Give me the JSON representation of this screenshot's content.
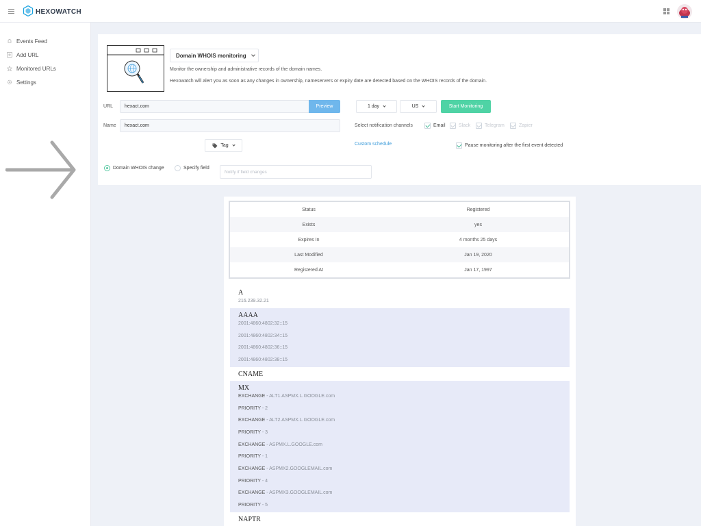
{
  "brand": {
    "name": "HEXOWATCH"
  },
  "sidebar": {
    "items": [
      {
        "label": "Events Feed",
        "icon": "bell-icon"
      },
      {
        "label": "Add URL",
        "icon": "plus-square-icon"
      },
      {
        "label": "Monitored URLs",
        "icon": "star-icon"
      },
      {
        "label": "Settings",
        "icon": "gear-icon"
      }
    ]
  },
  "monitor": {
    "type": "Domain WHOIS monitoring",
    "desc1": "Monitor the ownership and administrative records of the domain names.",
    "desc2": "Hexowatch will alert you as soon as any changes in ownership, nameservers or expiry date are detected based on the WHOIS records of the domain."
  },
  "form": {
    "url_label": "URL",
    "url_value": "hexact.com",
    "preview_label": "Preview",
    "name_label": "Name",
    "name_value": "hexact.com",
    "frequency": "1 day",
    "region": "US",
    "start_label": "Start Monitoring",
    "notify_label": "Select notification channels",
    "channels": [
      "Email",
      "Slack",
      "Telegram",
      "Zapier"
    ],
    "custom_schedule": "Custom schedule",
    "pause_label": "Pause monitoring after the first event detected",
    "tag_label": "Tag",
    "radio_whois": "Domain WHOIS change",
    "radio_field": "Specify field",
    "field_placeholder": "Notify if field changes"
  },
  "whois": {
    "rows": [
      {
        "key": "Status",
        "value": "Registered"
      },
      {
        "key": "Exists",
        "value": "yes"
      },
      {
        "key": "Expires In",
        "value": "4 months 25 days"
      },
      {
        "key": "Last Modified",
        "value": "Jan 19, 2020"
      },
      {
        "key": "Registered At",
        "value": "Jan 17, 1997"
      }
    ]
  },
  "dns": {
    "a": {
      "title": "A",
      "values": [
        "216.239.32.21"
      ]
    },
    "aaaa": {
      "title": "AAAA",
      "values": [
        "2001:4860:4802:32::15",
        "2001:4860:4802:34::15",
        "2001:4860:4802:36::15",
        "2001:4860:4802:38::15"
      ]
    },
    "cname": {
      "title": "CNAME"
    },
    "mx": {
      "title": "MX",
      "exchange_label": "EXCHANGE",
      "priority_label": "PRIORITY",
      "entries": [
        {
          "exchange": "ALT1.ASPMX.L.GOOGLE.com",
          "priority": "2"
        },
        {
          "exchange": "ALT2.ASPMX.L.GOOGLE.com",
          "priority": "3"
        },
        {
          "exchange": "ASPMX.L.GOOGLE.com",
          "priority": "1"
        },
        {
          "exchange": "ASPMX2.GOOGLEMAIL.com",
          "priority": "4"
        },
        {
          "exchange": "ASPMX3.GOOGLEMAIL.com",
          "priority": "5"
        }
      ]
    },
    "naptr": {
      "title": "NAPTR"
    }
  },
  "colors": {
    "accent": "#4fd3a5",
    "preview": "#6fb7ec",
    "band": "#e7eaf8",
    "link": "#3a9ad9"
  }
}
